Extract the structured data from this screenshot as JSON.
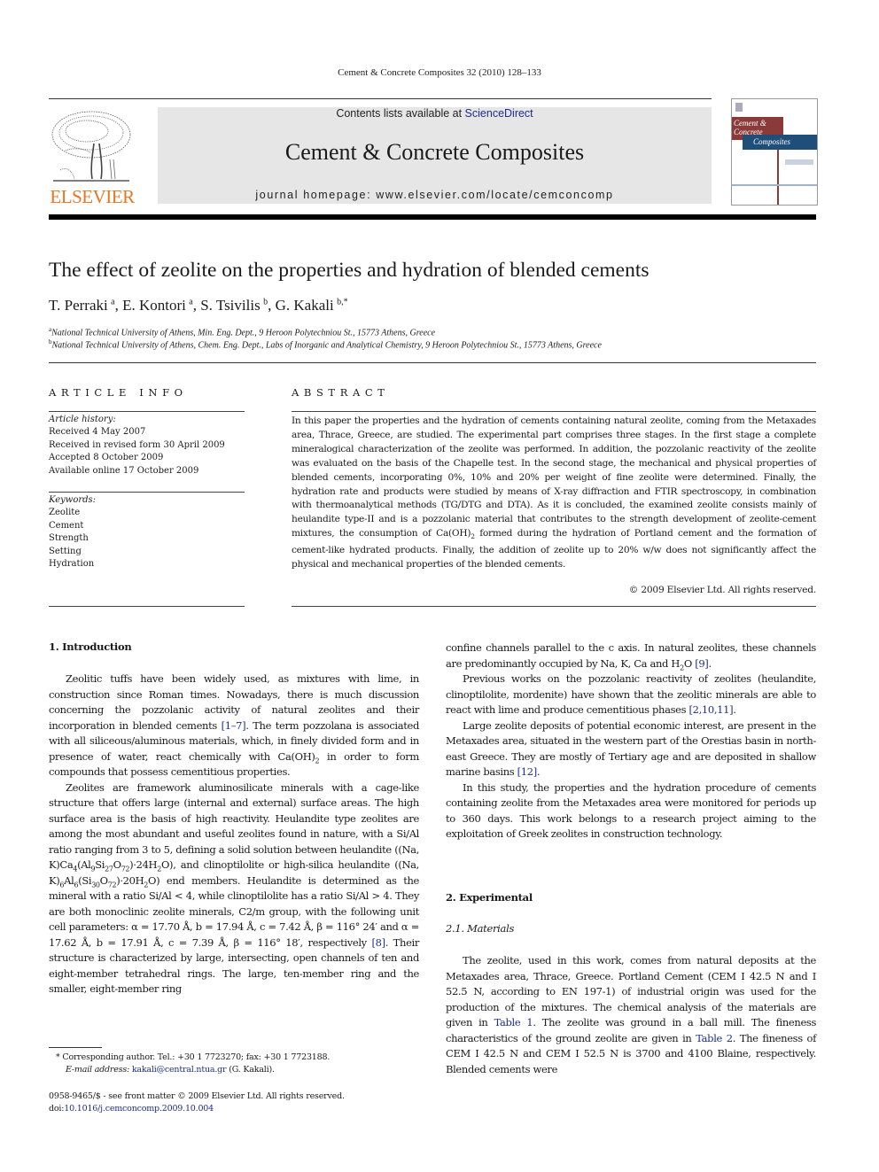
{
  "running_head": "Cement & Concrete Composites 32 (2010) 128–133",
  "publisher": {
    "logo_word": "ELSEVIER",
    "logo_icon": "elsevier-tree-logo",
    "brand_color": "#e87722"
  },
  "banner": {
    "contents_prefix": "Contents lists available at ",
    "contents_link": "ScienceDirect",
    "journal_title": "Cement & Concrete Composites",
    "homepage": "journal homepage: www.elsevier.com/locate/cemconcomp",
    "link_color": "#1b2e8c"
  },
  "cover": {
    "line1": "Cement &",
    "line2": "Concrete",
    "line3": "Composites",
    "red": "#8b3a3a",
    "blue": "#1f4e79"
  },
  "article": {
    "title": "The effect of zeolite on the properties and hydration of blended cements",
    "authors": [
      {
        "name": "T. Perraki",
        "sup": "a"
      },
      {
        "name": "E. Kontori",
        "sup": "a"
      },
      {
        "name": "S. Tsivilis",
        "sup": "b"
      },
      {
        "name": "G. Kakali",
        "sup": "b,*"
      }
    ],
    "affiliations": [
      {
        "sup": "a",
        "text": "National Technical University of Athens, Min. Eng. Dept., 9 Heroon Polytechniou St., 15773 Athens, Greece"
      },
      {
        "sup": "b",
        "text": "National Technical University of Athens, Chem. Eng. Dept., Labs of Inorganic and Analytical Chemistry, 9 Heroon Polytechniou St., 15773 Athens, Greece"
      }
    ]
  },
  "article_info": {
    "heading": "ARTICLE INFO",
    "history_label": "Article history:",
    "history": [
      "Received 4 May 2007",
      "Received in revised form 30 April 2009",
      "Accepted 8 October 2009",
      "Available online 17 October 2009"
    ],
    "keywords_label": "Keywords:",
    "keywords": [
      "Zeolite",
      "Cement",
      "Strength",
      "Setting",
      "Hydration"
    ]
  },
  "abstract": {
    "heading": "ABSTRACT",
    "text_before_sub": "In this paper the properties and the hydration of cements containing natural zeolite, coming from the Metaxades area, Thrace, Greece, are studied. The experimental part comprises three stages. In the first stage a complete mineralogical characterization of the zeolite was performed. In addition, the pozzolanic reactivity of the zeolite was evaluated on the basis of the Chapelle test. In the second stage, the mechanical and physical properties of blended cements, incorporating 0%, 10% and 20% per weight of fine zeolite were determined. Finally, the hydration rate and products were studied by means of X-ray diffraction and FTIR spectroscopy, in combination with thermoanalytical methods (TG/DTG and DTA). As it is concluded, the examined zeolite consists mainly of heulandite type-II and is a pozzolanic material that contributes to the strength development of zeolite-cement mixtures, the consumption of Ca(OH)",
    "sub": "2",
    "text_after_sub": " formed during the hydration of Portland cement and the formation of cement-like hydrated products. Finally, the addition of zeolite up to 20% w/w does not significantly affect the physical and mechanical properties of the blended cements.",
    "copyright": "© 2009 Elsevier Ltd. All rights reserved."
  },
  "body": {
    "sec1_heading": "1. Introduction",
    "p1": {
      "a": "Zeolitic tuffs have been widely used, as mixtures with lime, in construction since Roman times. Nowadays, there is much discussion concerning the pozzolanic activity of natural zeolites and their incorporation in blended cements ",
      "ref": "[1–7]",
      "b": ". The term pozzolana is associated with all siliceous/aluminous materials, which, in finely divided form and in presence of water, react chemically with Ca(OH)",
      "sub": "2",
      "c": " in order to form compounds that possess cementitious properties."
    },
    "p2": {
      "a": "Zeolites are framework aluminosilicate minerals with a cage-like structure that offers large (internal and external) surface areas. The high surface area is the basis of high reactivity. Heulandite type zeolites are among the most abundant and useful zeolites found in nature, with a Si/Al ratio ranging from 3 to 5, defining a solid solution between heulandite ((Na, K)Ca",
      "s1": "4",
      "b": "(Al",
      "s2": "9",
      "c": "Si",
      "s3": "27",
      "d": "O",
      "s4": "72",
      "e": ")·24H",
      "s5": "2",
      "f": "O), and clinoptilolite or high-silica heulandite ((Na, K)",
      "s6": "6",
      "g": "Al",
      "s7": "6",
      "h": "(Si",
      "s8": "30",
      "i": "O",
      "s9": "72",
      "j": ")·20H",
      "s10": "2",
      "k": "O) end members. Heulandite is determined as the mineral with a ratio Si/Al < 4, while clinoptilolite has a ratio Si/Al > 4. They are both monoclinic zeolite minerals, C2/m group, with the following unit cell parameters: α = 17.70 Å, b = 17.94 Å, c = 7.42 Å, β = 116° 24′ and α = 17.62 Å, b = 17.91 Å, c = 7.39 Å, β = 116° 18′, respectively ",
      "ref": "[8]",
      "l": ". Their structure is characterized by large, intersecting, open channels of ten and eight-member tetrahedral rings. The large, ten-member ring and the smaller, eight-member ring confine channels parallel to the c axis. In natural zeolites, these channels are predominantly occupied by Na, K, Ca and H",
      "s11": "2",
      "m": "O ",
      "ref2": "[9]",
      "n": "."
    },
    "p3": {
      "a": "Previous works on the pozzolanic reactivity of zeolites (heulandite, clinoptilolite, mordenite) have shown that the zeolitic minerals are able to react with lime and produce cementitious phases ",
      "ref": "[2,10,11]",
      "b": "."
    },
    "p4": {
      "a": "Large zeolite deposits of potential economic interest, are present in the Metaxades area, situated in the western part of the Orestias basin in north-east Greece. They are mostly of Tertiary age and are deposited in shallow marine basins ",
      "ref": "[12]",
      "b": "."
    },
    "p5": "In this study, the properties and the hydration procedure of cements containing zeolite from the Metaxades area were monitored for periods up to 360 days. This work belongs to a research project aiming to the exploitation of Greek zeolites in construction technology.",
    "sec2_heading": "2. Experimental",
    "sec21_heading": "2.1. Materials",
    "p6": {
      "a": "The zeolite, used in this work, comes from natural deposits at the Metaxades area, Thrace, Greece. Portland Cement (CEM I 42.5 N and I 52.5 N, according to EN 197-1) of industrial origin was used for the production of the mixtures. The chemical analysis of the materials are given in ",
      "ref1": "Table 1",
      "b": ". The zeolite was ground in a ball mill. The fineness characteristics of the ground zeolite are given in ",
      "ref2": "Table 2",
      "c": ". The fineness of CEM I 42.5 N and CEM I 52.5 N is 3700 and 4100 Blaine, respectively. Blended cements were"
    }
  },
  "footnotes": {
    "corresponding": "* Corresponding author. Tel.: +30 1 7723270; fax: +30 1 7723188.",
    "email_label": "E-mail address: ",
    "email": "kakali@central.ntua.gr",
    "email_suffix": " (G. Kakali).",
    "issn": "0958-9465/$ - see front matter © 2009 Elsevier Ltd. All rights reserved.",
    "doi_label": "doi:",
    "doi": "10.1016/j.cemconcomp.2009.10.004"
  }
}
